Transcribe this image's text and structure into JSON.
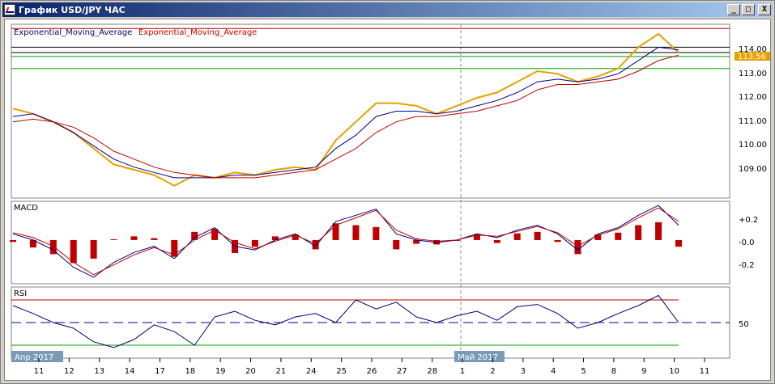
{
  "window": {
    "title": "График USD/JPY ЧАС",
    "buttons": {
      "minimize": "_",
      "maximize": "□",
      "close": "X"
    }
  },
  "main_panel": {
    "indicator_label_1": "Exponential_Moving_Average",
    "indicator_label_2": "Exponential_Moving_Average",
    "price_ticks": [
      "114.00",
      "113.00",
      "112.00",
      "111.00",
      "110.00",
      "109.00"
    ],
    "current_price": "113.56"
  },
  "macd_panel": {
    "label": "MACD",
    "ticks": [
      "+0.2",
      "-0.0",
      "-0.2"
    ]
  },
  "rsi_panel": {
    "label": "RSI",
    "ticks": [
      "50"
    ]
  },
  "time_axis": {
    "month_start_1": "Апр 2017",
    "month_start_2": "Май 2017",
    "day_labels": [
      "11",
      "12",
      "13",
      "14",
      "17",
      "18",
      "19",
      "20",
      "21",
      "24",
      "25",
      "26",
      "27",
      "28",
      "1",
      "2",
      "3",
      "4",
      "5",
      "8",
      "9",
      "10",
      "11"
    ]
  },
  "colors": {
    "price": "#e8a000",
    "ema_fast": "#000080",
    "ema_slow": "#c00000",
    "level_red": "#c00000",
    "level_green": "#00a000",
    "rsi_line": "#000080",
    "rsi_over": "#a000c0",
    "rsi_under": "#00c000",
    "macd_hist": "#c00000"
  },
  "chart_data": [
    {
      "type": "line",
      "panel": "price",
      "y_ticks": [
        109,
        110,
        111,
        112,
        113,
        114
      ],
      "ylim": [
        108.2,
        114.6
      ],
      "current_value": 113.56,
      "horizontal_levels": [
        {
          "value": 114.5,
          "color": "red"
        },
        {
          "value": 113.8,
          "color": "black"
        },
        {
          "value": 113.6,
          "color": "black"
        },
        {
          "value": 113.45,
          "color": "green"
        },
        {
          "value": 113.0,
          "color": "green"
        }
      ],
      "series": [
        {
          "values": [
            111.5,
            111.3,
            111.0,
            110.6,
            110.0,
            109.4,
            109.2,
            109.0,
            108.6,
            109.0,
            108.9,
            109.1,
            109.0,
            109.2,
            109.3,
            109.2,
            110.3,
            111.0,
            111.7,
            111.7,
            111.6,
            111.3,
            111.6,
            111.9,
            112.1,
            112.5,
            112.9,
            112.8,
            112.5,
            112.7,
            113.0,
            113.8,
            114.3,
            113.6
          ]
        },
        {
          "values": [
            111.2,
            111.3,
            111.0,
            110.6,
            110.1,
            109.6,
            109.3,
            109.1,
            108.9,
            108.9,
            108.9,
            109.0,
            109.0,
            109.1,
            109.2,
            109.3,
            110.0,
            110.5,
            111.2,
            111.4,
            111.4,
            111.3,
            111.4,
            111.6,
            111.8,
            112.1,
            112.5,
            112.6,
            112.5,
            112.6,
            112.8,
            113.3,
            113.8,
            113.7
          ]
        },
        {
          "values": [
            111.0,
            111.1,
            111.0,
            110.8,
            110.4,
            109.9,
            109.6,
            109.3,
            109.1,
            109.0,
            108.9,
            108.9,
            108.9,
            109.0,
            109.1,
            109.2,
            109.6,
            110.0,
            110.6,
            111.0,
            111.2,
            111.2,
            111.3,
            111.4,
            111.6,
            111.8,
            112.2,
            112.4,
            112.4,
            112.5,
            112.6,
            112.9,
            113.3,
            113.5
          ]
        }
      ]
    },
    {
      "type": "line",
      "panel": "macd",
      "y_ticks": [
        0.2,
        0.0,
        -0.2
      ],
      "ylim": [
        -0.34,
        0.3
      ],
      "series": [
        {
          "values": [
            0.05,
            0.0,
            -0.08,
            -0.22,
            -0.3,
            -0.18,
            -0.1,
            -0.05,
            -0.15,
            0.02,
            0.1,
            -0.05,
            -0.08,
            0.0,
            0.05,
            -0.05,
            0.15,
            0.2,
            0.25,
            0.05,
            0.0,
            -0.02,
            0.0,
            0.05,
            0.02,
            0.08,
            0.12,
            0.05,
            -0.08,
            0.05,
            0.1,
            0.2,
            0.28,
            0.12
          ]
        },
        {
          "values": [
            0.06,
            0.02,
            -0.05,
            -0.18,
            -0.28,
            -0.2,
            -0.12,
            -0.06,
            -0.12,
            0.0,
            0.08,
            -0.02,
            -0.07,
            -0.01,
            0.04,
            -0.03,
            0.12,
            0.18,
            0.24,
            0.08,
            0.01,
            -0.01,
            0.0,
            0.04,
            0.03,
            0.07,
            0.11,
            0.06,
            -0.05,
            0.04,
            0.09,
            0.18,
            0.26,
            0.15
          ]
        }
      ]
    },
    {
      "type": "line",
      "panel": "rsi",
      "y_ticks": [
        50
      ],
      "ylim": [
        20,
        80
      ],
      "levels": [
        70,
        50,
        30
      ],
      "series": [
        {
          "values": [
            65,
            58,
            50,
            45,
            33,
            28,
            35,
            48,
            42,
            30,
            55,
            60,
            52,
            48,
            55,
            58,
            50,
            70,
            62,
            68,
            55,
            50,
            56,
            60,
            52,
            64,
            66,
            58,
            45,
            50,
            58,
            65,
            74,
            50
          ]
        }
      ]
    }
  ]
}
